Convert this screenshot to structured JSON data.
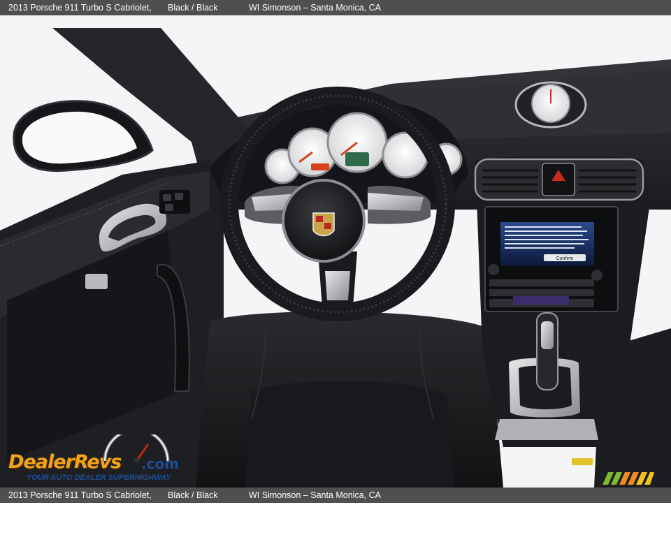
{
  "header": {
    "title": "2013 Porsche 911 Turbo S Cabriolet,",
    "color": "Black / Black",
    "dealer": "WI Simonson – Santa Monica, CA"
  },
  "footer": {
    "title": "2013 Porsche 911 Turbo S Cabriolet,",
    "color": "Black / Black",
    "dealer": "WI Simonson – Santa Monica, CA"
  },
  "watermark": {
    "brand": "DealerRevs",
    "domain": ".com",
    "tagline": "YOUR AUTO DEALER SUPERHIGHWAY"
  },
  "photo": {
    "subject": "car-interior-dashboard",
    "nav_screen_button": "Confirm"
  },
  "colors": {
    "bar_background": "#4f4f4f",
    "bar_text": "#ffffff",
    "brand_orange": "#f2a31a",
    "brand_blue": "#1d4d9a"
  }
}
